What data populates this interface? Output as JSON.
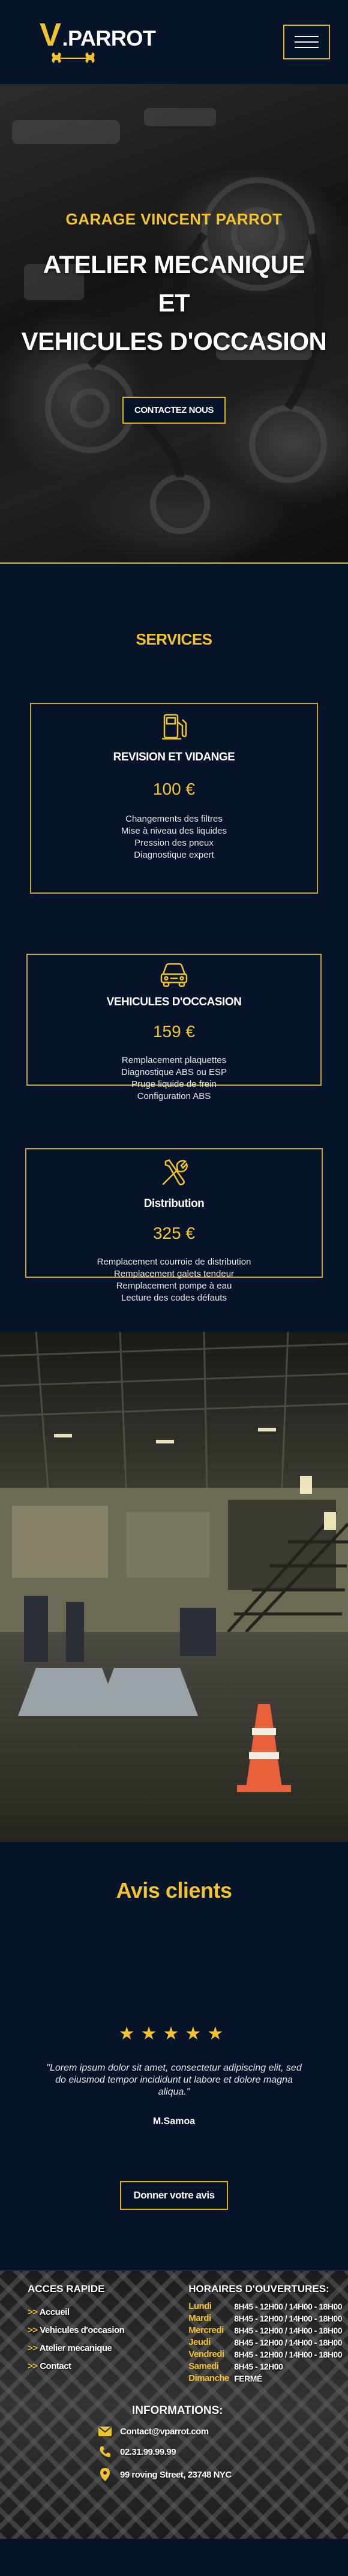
{
  "header": {
    "logo_v": "V",
    "logo_rest": ".PARROT"
  },
  "hero": {
    "subtitle": "GARAGE VINCENT PARROT",
    "title_line1": "ATELIER MECANIQUE",
    "title_line2": "ET",
    "title_line3": "VEHICULES D'OCCASION",
    "cta_label": "CONTACTEZ NOUS"
  },
  "services": {
    "title": "SERVICES",
    "cards": [
      {
        "icon": "fuel-pump-icon",
        "title": "REVISION ET VIDANGE",
        "price": "100 €",
        "lines": [
          "Changements des filtres",
          "Mise à niveau des liquides",
          "Pression des pneux",
          "Diagnostique expert"
        ]
      },
      {
        "icon": "car-icon",
        "title": "VEHICULES D'OCCASION",
        "price": "159 €",
        "lines": [
          "Remplacement plaquettes",
          "Diagnostique ABS ou ESP",
          "Pruge liquide de frein",
          "Configuration ABS"
        ]
      },
      {
        "icon": "tools-icon",
        "title": "Distribution",
        "price": "325 €",
        "lines": [
          "Remplacement courroie de distribution",
          "Remplacement galets tendeur",
          "Remplacement pompe à eau",
          "Lecture des codes défauts"
        ]
      }
    ]
  },
  "reviews": {
    "title": "Avis clients",
    "stars": "★★★★★",
    "rating": 5,
    "text": "\"Lorem ipsum dolor sit amet, consectetur adipiscing elit, sed do eiusmod tempor incididunt ut labore et dolore magna aliqua.\"",
    "author": "M.Samoa",
    "button_label": "Donner votre avis"
  },
  "footer": {
    "quick_title": "ACCES RAPIDE",
    "arrow": ">>",
    "links": [
      "Accueil",
      "Vehicules d'occasion",
      "Atelier mecanique",
      "Contact"
    ],
    "hours_title": "HORAIRES D'OUVERTURES:",
    "hours": [
      {
        "day": "Lundi",
        "time": "8H45 - 12H00 / 14H00 - 18H00"
      },
      {
        "day": "Mardi",
        "time": "8H45 - 12H00 / 14H00 - 18H00"
      },
      {
        "day": "Mercredi",
        "time": "8H45 - 12H00 / 14H00 - 18H00"
      },
      {
        "day": "Jeudi",
        "time": "8H45 - 12H00 / 14H00 - 18H00"
      },
      {
        "day": "Vendredi",
        "time": "8H45 - 12H00 / 14H00 - 18H00"
      },
      {
        "day": "Samedi",
        "time": "8H45 - 12H00"
      },
      {
        "day": "Dimanche",
        "time": "FERMÉ"
      }
    ],
    "info_title": "INFORMATIONS:",
    "email": "Contact@vparrot.com",
    "phone": "02.31.99.99.99",
    "address": "99 roving Street, 23748 NYC"
  },
  "colors": {
    "navy": "#061429",
    "gold": "#f2c32f",
    "border_gold": "#c6a53c"
  }
}
